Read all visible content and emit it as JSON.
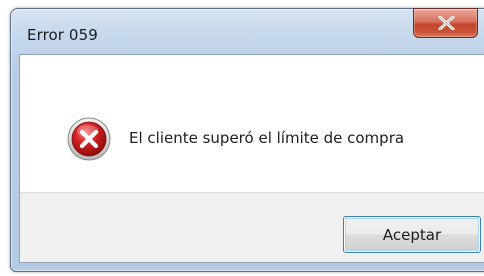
{
  "window": {
    "title": "Error 059"
  },
  "dialog": {
    "icon": "error-icon",
    "message": "El cliente superó el límite de compra",
    "ok_label": "Aceptar"
  },
  "colors": {
    "close_button": "#c75238",
    "error_icon": "#d42020",
    "footer_background": "#f0f0f0",
    "titlebar": "#c6d8ec"
  }
}
